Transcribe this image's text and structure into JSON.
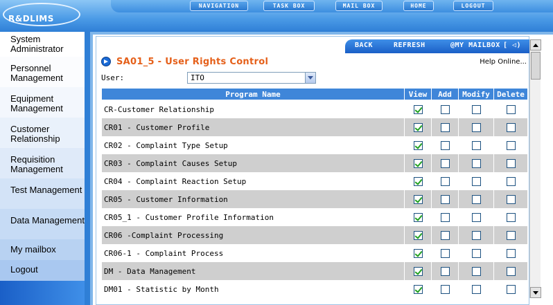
{
  "app": {
    "logo_text": "R&DLIMS"
  },
  "topnav": [
    "NAVIGATION",
    "TASK BOX",
    "MAIL BOX",
    "HOME",
    "LOGOUT"
  ],
  "sidebar": {
    "items": [
      "System Administrator",
      "Personnel Management",
      "Equipment Management",
      "Customer Relationship",
      "Requisition Management",
      "Test Management",
      "Data Management",
      "My mailbox",
      "Logout"
    ]
  },
  "actions": {
    "back": "BACK",
    "refresh": "REFRESH",
    "mailbox": "@MY MAILBOX"
  },
  "page": {
    "title": "SA01_5 - User Rights Control",
    "help": "Help Online..."
  },
  "user_filter": {
    "label": "User:",
    "value": "ITO"
  },
  "table": {
    "headers": {
      "program": "Program Name",
      "view": "View",
      "add": "Add",
      "modify": "Modify",
      "delete": "Delete"
    },
    "rows": [
      {
        "name": "CR-Customer Relationship",
        "view": true,
        "add": false,
        "modify": false,
        "delete": false
      },
      {
        "name": "CR01 - Customer Profile",
        "view": true,
        "add": false,
        "modify": false,
        "delete": false
      },
      {
        "name": "CR02 - Complaint Type Setup",
        "view": true,
        "add": false,
        "modify": false,
        "delete": false
      },
      {
        "name": "CR03 - Complaint Causes Setup",
        "view": true,
        "add": false,
        "modify": false,
        "delete": false
      },
      {
        "name": "CR04 - Complaint Reaction Setup",
        "view": true,
        "add": false,
        "modify": false,
        "delete": false
      },
      {
        "name": "CR05 - Customer Information",
        "view": true,
        "add": false,
        "modify": false,
        "delete": false
      },
      {
        "name": "CR05_1 - Customer Profile Information",
        "view": true,
        "add": false,
        "modify": false,
        "delete": false
      },
      {
        "name": "CR06 -Complaint Processing",
        "view": true,
        "add": false,
        "modify": false,
        "delete": false
      },
      {
        "name": "CR06-1 - Complaint Process",
        "view": true,
        "add": false,
        "modify": false,
        "delete": false
      },
      {
        "name": "DM - Data Management",
        "view": true,
        "add": false,
        "modify": false,
        "delete": false
      },
      {
        "name": "DM01 - Statistic by Month",
        "view": true,
        "add": false,
        "modify": false,
        "delete": false
      }
    ]
  }
}
